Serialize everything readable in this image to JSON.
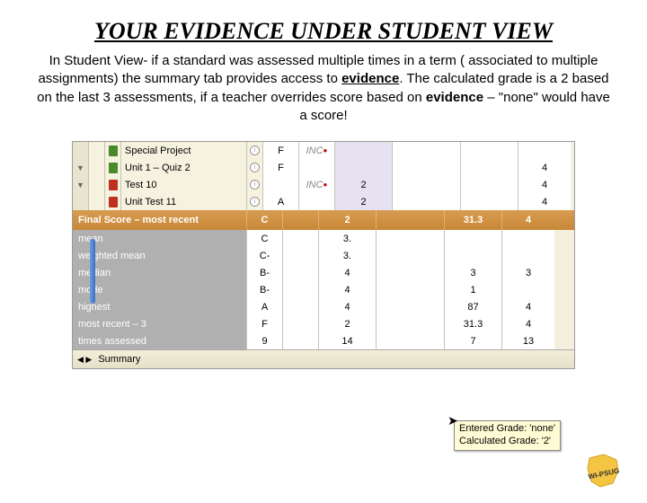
{
  "title": "YOUR EVIDENCE UNDER STUDENT VIEW",
  "desc": {
    "t1": "In Student View- if a standard was assessed multiple times in a term ( associated to multiple assignments) the summary tab provides access to ",
    "evidence1": "evidence",
    "t2": ". The calculated grade is a 2 based on the last 3 assessments, if a teacher overrides score based on ",
    "evidence2": "evidence",
    "t3": " – \"none\" would have a score!"
  },
  "top_rows": [
    {
      "handle": "",
      "ico1": "",
      "ico2": "green",
      "name": "Special Project",
      "letter": "F",
      "inc": "INC",
      "n1": "",
      "n2": "",
      "n3": "",
      "n4": ""
    },
    {
      "handle": "▼",
      "ico1": "",
      "ico2": "green",
      "name": "Unit 1 – Quiz 2",
      "letter": "F",
      "inc": "",
      "n1": "",
      "n2": "",
      "n3": "",
      "n4": "4"
    },
    {
      "handle": "▼",
      "ico1": "",
      "ico2": "red",
      "name": "Test 10",
      "letter": "",
      "inc": "INC",
      "n1": "2",
      "n2": "",
      "n3": "",
      "n4": "4"
    },
    {
      "handle": "",
      "ico1": "",
      "ico2": "red",
      "name": "Unit Test 11",
      "letter": "A",
      "inc": "",
      "n1": "2",
      "n2": "",
      "n3": "",
      "n4": "4"
    }
  ],
  "final": {
    "label": "Final Score – most recent",
    "letter": "C",
    "n1": "2",
    "n2": "",
    "n3": "31.3",
    "n4": "4"
  },
  "stats": [
    {
      "name": "mean",
      "letter": "C",
      "n1": "3.",
      "n2": "",
      "n3": "",
      "n4": ""
    },
    {
      "name": "weighted mean",
      "letter": "C-",
      "n1": "3.",
      "n2": "",
      "n3": "",
      "n4": ""
    },
    {
      "name": "median",
      "letter": "B-",
      "n1": "4",
      "n2": "",
      "n3": "3",
      "n4": "3"
    },
    {
      "name": "mode",
      "letter": "B-",
      "n1": "4",
      "n2": "",
      "n3": "1",
      "n4": ""
    },
    {
      "name": "highest",
      "letter": "A",
      "n1": "4",
      "n2": "",
      "n3": "87",
      "n4": "4"
    },
    {
      "name": "most recent – 3",
      "letter": "F",
      "n1": "2",
      "n2": "",
      "n3": "31.3",
      "n4": "4"
    },
    {
      "name": "times assessed",
      "letter": "9",
      "n1": "14",
      "n2": "",
      "n3": "7",
      "n4": "13"
    }
  ],
  "toolbar": {
    "label": "Summary"
  },
  "tooltip": {
    "line1": "Entered Grade: 'none'",
    "line2": "Calculated Grade: '2'"
  },
  "logo_text": "WI-PSUG"
}
